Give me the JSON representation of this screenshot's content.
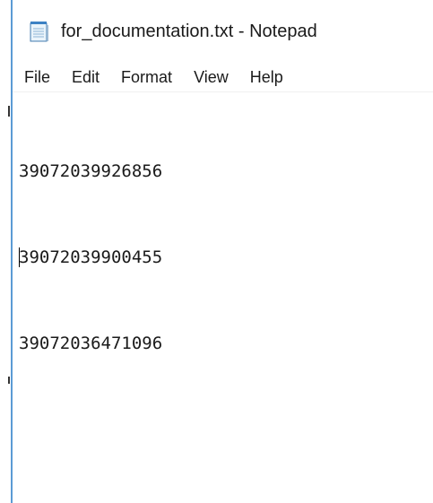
{
  "window": {
    "title": "for_documentation.txt - Notepad",
    "icon": "notepad-icon",
    "accent_color": "#5b9bd5"
  },
  "menu": {
    "items": [
      {
        "label": "File"
      },
      {
        "label": "Edit"
      },
      {
        "label": "Format"
      },
      {
        "label": "View"
      },
      {
        "label": "Help"
      }
    ]
  },
  "editor": {
    "lines": [
      "39072039926856",
      "39072039900455",
      "39072036471096"
    ]
  }
}
